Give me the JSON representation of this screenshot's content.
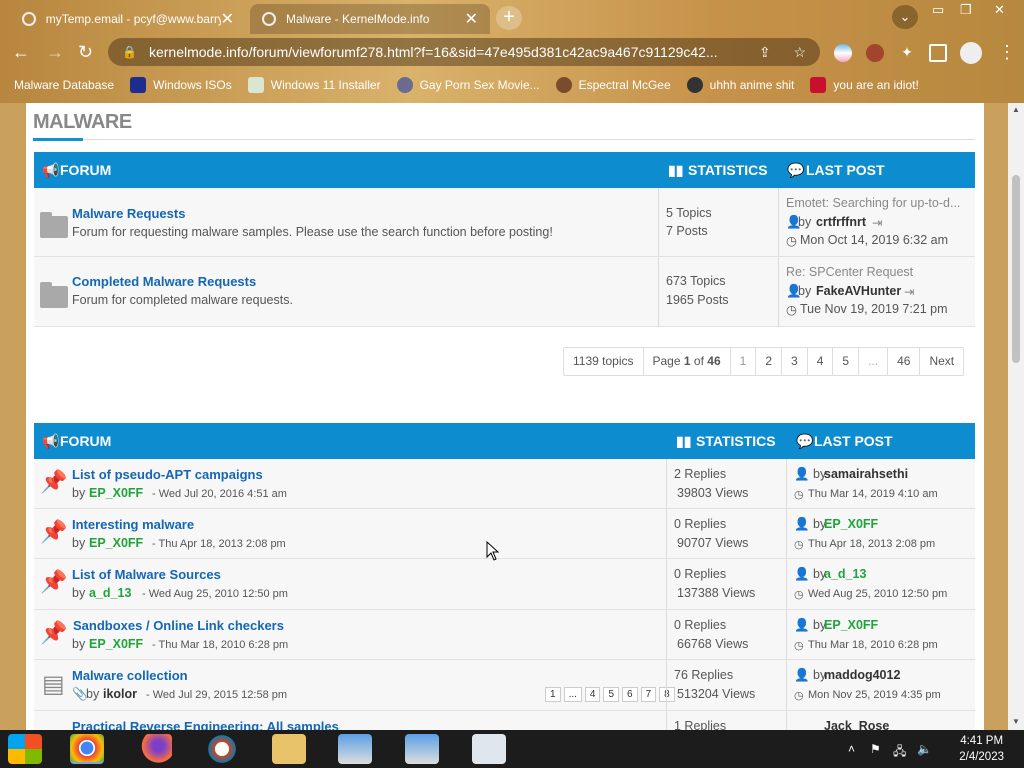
{
  "browser": {
    "tabs": [
      {
        "title": "myTemp.email - pcyf@www.barry",
        "close": "✕"
      },
      {
        "title": "Malware - KernelMode.info",
        "close": "✕"
      }
    ],
    "new_tab": "+",
    "url": "kernelmode.info/forum/viewforumf278.html?f=16&sid=47e495d381c42ac9a467c91129c42...",
    "bookmarks": [
      "Malware Database",
      "Windows ISOs",
      "Windows 11 Installer",
      "Gay Porn Sex Movie...",
      "Espectral McGee",
      "uhhh anime shit",
      "you are an idiot!"
    ]
  },
  "section_title": "MALWARE",
  "forum_table": {
    "headers": {
      "forum": "FORUM",
      "statistics": "STATISTICS",
      "last_post": "LAST POST"
    },
    "rows": [
      {
        "title": "Malware Requests",
        "desc": "Forum for requesting malware samples. Please use the search function before posting!",
        "topics": "5 Topics",
        "posts": "7 Posts",
        "last_title": "Emotet: Searching for up-to-d...",
        "by": "by",
        "last_user": "crtfrffnrt",
        "last_date": "Mon Oct 14, 2019 6:32 am"
      },
      {
        "title": "Completed Malware Requests",
        "desc": "Forum for completed malware requests.",
        "topics": "673 Topics",
        "posts": "1965 Posts",
        "last_title": "Re: SPCenter Request",
        "by": "by",
        "last_user": "FakeAVHunter",
        "last_date": "Tue Nov 19, 2019 7:21 pm"
      }
    ]
  },
  "pagination": {
    "topics": "1139 topics",
    "page_label": "Page",
    "page_current": "1",
    "page_of": "of",
    "page_total": "46",
    "pages": [
      "1",
      "2",
      "3",
      "4",
      "5",
      "...",
      "46"
    ],
    "next": "Next"
  },
  "topic_table": {
    "headers": {
      "forum": "FORUM",
      "statistics": "STATISTICS",
      "last_post": "LAST POST"
    },
    "rows": [
      {
        "title": "List of pseudo-APT campaigns",
        "by": "by",
        "author": "EP_X0FF",
        "date": "- Wed Jul 20, 2016 4:51 am",
        "replies": "2 Replies",
        "views": "39803 Views",
        "last_user": "samairahsethi",
        "last_date": "Thu Mar 14, 2019 4:10 am"
      },
      {
        "title": "Interesting malware",
        "by": "by",
        "author": "EP_X0FF",
        "date": "- Thu Apr 18, 2013 2:08 pm",
        "replies": "0 Replies",
        "views": "90707 Views",
        "last_user": "EP_X0FF",
        "last_date": "Thu Apr 18, 2013 2:08 pm"
      },
      {
        "title": "List of Malware Sources",
        "by": "by",
        "author": "a_d_13",
        "date": "- Wed Aug 25, 2010 12:50 pm",
        "replies": "0 Replies",
        "views": "137388 Views",
        "last_user": "a_d_13",
        "last_date": "Wed Aug 25, 2010 12:50 pm"
      },
      {
        "title": "Sandboxes / Online Link checkers",
        "by": "by",
        "author": "EP_X0FF",
        "date": "- Thu Mar 18, 2010 6:28 pm",
        "replies": "0 Replies",
        "views": "66768 Views",
        "last_user": "EP_X0FF",
        "last_date": "Thu Mar 18, 2010 6:28 pm"
      },
      {
        "title": "Malware collection",
        "by": "by",
        "author": "ikolor",
        "date": "- Wed Jul 29, 2015 12:58 pm",
        "replies": "76 Replies",
        "views": "513204 Views",
        "last_user": "maddog4012",
        "last_date": "Mon Nov 25, 2019 4:35 pm",
        "pages": [
          "1",
          "...",
          "4",
          "5",
          "6",
          "7",
          "8"
        ]
      },
      {
        "title": "Practical Reverse Engineering: All samples",
        "replies": "1 Replies",
        "last_user": "Jack_Rose"
      }
    ]
  },
  "taskbar": {
    "time": "4:41 PM",
    "date": "2/4/2023"
  }
}
